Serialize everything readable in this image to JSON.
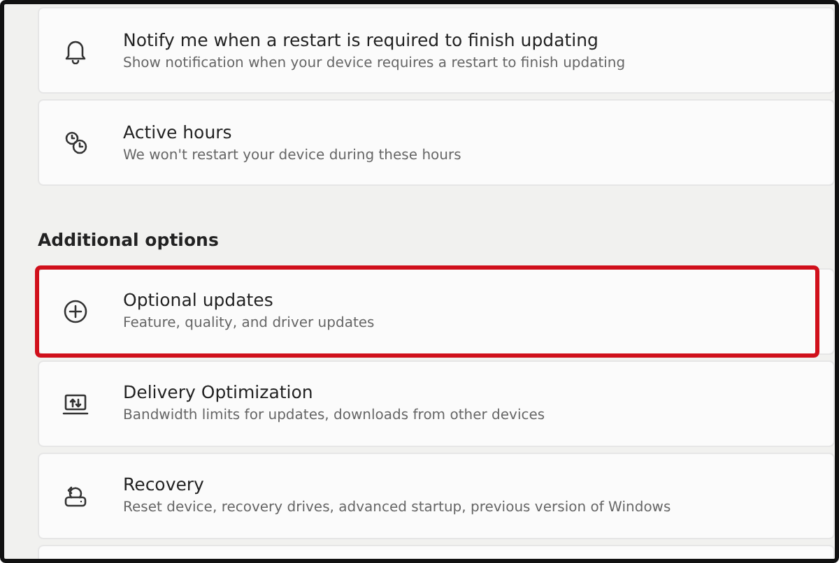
{
  "groups": [
    {
      "items": [
        {
          "title": "Notify me when a restart is required to finish updating",
          "subtitle": "Show notification when your device requires a restart to finish updating",
          "highlighted": false
        },
        {
          "title": "Active hours",
          "subtitle": "We won't restart your device during these hours",
          "highlighted": false
        }
      ]
    },
    {
      "heading": "Additional options",
      "items": [
        {
          "title": "Optional updates",
          "subtitle": "Feature, quality, and driver updates",
          "highlighted": true
        },
        {
          "title": "Delivery Optimization",
          "subtitle": "Bandwidth limits for updates, downloads from other devices",
          "highlighted": false
        },
        {
          "title": "Recovery",
          "subtitle": "Reset device, recovery drives, advanced startup, previous version of Windows",
          "highlighted": false
        }
      ]
    }
  ]
}
